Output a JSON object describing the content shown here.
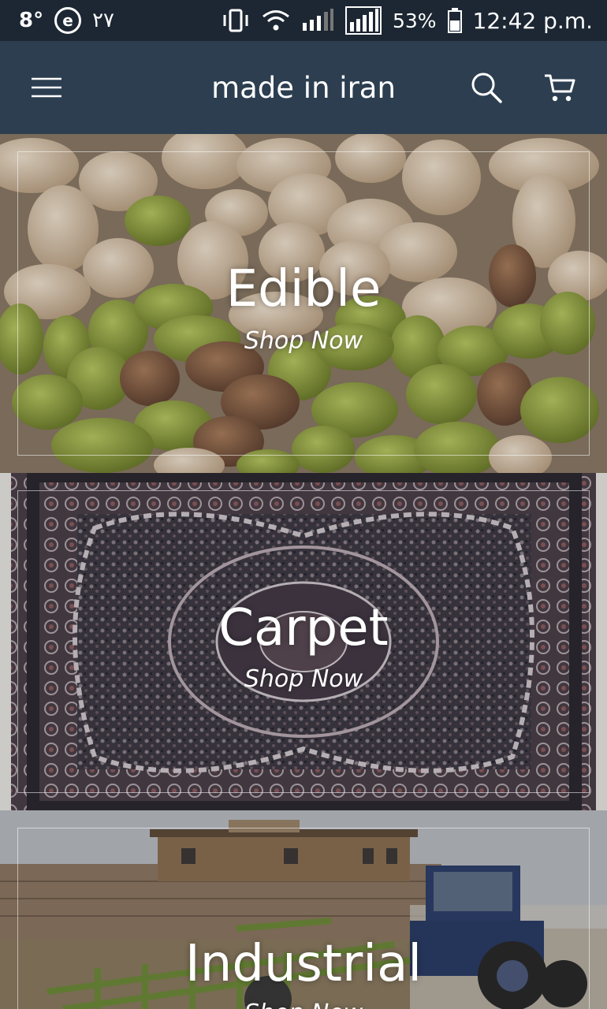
{
  "status_bar": {
    "temperature": "8°",
    "notification_icon": "e",
    "number": "۲۷",
    "battery": "53%",
    "time": "12:42 p.m."
  },
  "app_bar": {
    "title": "made in iran",
    "menu_icon": "hamburger-icon",
    "search_icon": "search-icon",
    "cart_icon": "cart-icon"
  },
  "categories": [
    {
      "title": "Edible",
      "cta": "Shop Now",
      "image": "pistachios"
    },
    {
      "title": "Carpet",
      "cta": "Shop Now",
      "image": "persian-carpet"
    },
    {
      "title": "Industrial",
      "cta": "Shop Now",
      "image": "tractor-field"
    }
  ],
  "colors": {
    "status_bar": "#1d2733",
    "app_bar": "#2c3e50",
    "text": "#ffffff"
  }
}
